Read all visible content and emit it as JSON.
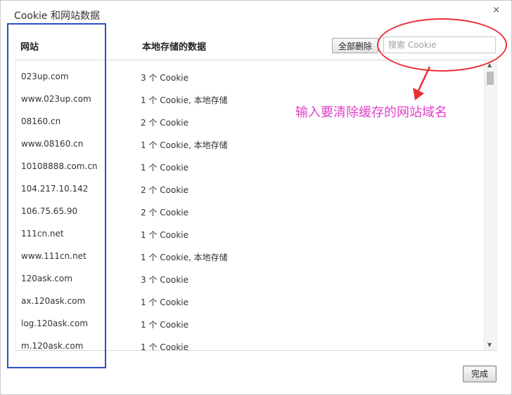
{
  "dialog": {
    "title": "Cookie 和网站数据",
    "close_glyph": "×"
  },
  "columns": {
    "site": "网站",
    "data": "本地存储的数据"
  },
  "toolbar": {
    "delete_all_label": "全部删除",
    "search_placeholder": "搜索 Cookie"
  },
  "rows": [
    {
      "site": "023up.com",
      "data": "3 个 Cookie"
    },
    {
      "site": "www.023up.com",
      "data": "1 个 Cookie, 本地存储"
    },
    {
      "site": "08160.cn",
      "data": "2 个 Cookie"
    },
    {
      "site": "www.08160.cn",
      "data": "1 个 Cookie, 本地存储"
    },
    {
      "site": "10108888.com.cn",
      "data": "1 个 Cookie"
    },
    {
      "site": "104.217.10.142",
      "data": "2 个 Cookie"
    },
    {
      "site": "106.75.65.90",
      "data": "2 个 Cookie"
    },
    {
      "site": "111cn.net",
      "data": "1 个 Cookie"
    },
    {
      "site": "www.111cn.net",
      "data": "1 个 Cookie, 本地存储"
    },
    {
      "site": "120ask.com",
      "data": "3 个 Cookie"
    },
    {
      "site": "ax.120ask.com",
      "data": "1 个 Cookie"
    },
    {
      "site": "log.120ask.com",
      "data": "1 个 Cookie"
    },
    {
      "site": "m.120ask.com",
      "data": "1 个 Cookie"
    }
  ],
  "annotation": {
    "text": "输入要清除缓存的网站域名",
    "color": "#e13fc9",
    "oval_color": "#ea2f38",
    "box_color": "#2c4fc6"
  },
  "footer": {
    "done_label": "完成"
  }
}
